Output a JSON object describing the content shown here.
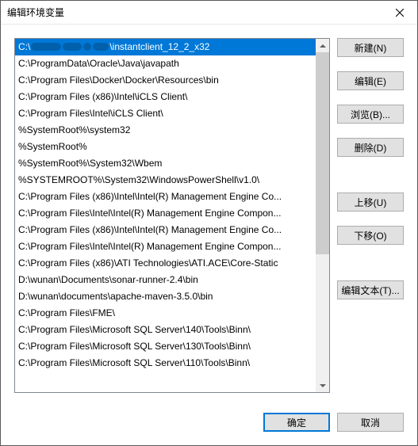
{
  "title": "编辑环境变量",
  "paths": {
    "selected_prefix": "C:\\",
    "selected_suffix": "\\instantclient_12_2_x32",
    "items": [
      "",
      "C:\\ProgramData\\Oracle\\Java\\javapath",
      "C:\\Program Files\\Docker\\Docker\\Resources\\bin",
      "C:\\Program Files (x86)\\Intel\\iCLS Client\\",
      "C:\\Program Files\\Intel\\iCLS Client\\",
      "%SystemRoot%\\system32",
      "%SystemRoot%",
      "%SystemRoot%\\System32\\Wbem",
      "%SYSTEMROOT%\\System32\\WindowsPowerShell\\v1.0\\",
      "C:\\Program Files (x86)\\Intel\\Intel(R) Management Engine Co...",
      "C:\\Program Files\\Intel\\Intel(R) Management Engine Compon...",
      "C:\\Program Files (x86)\\Intel\\Intel(R) Management Engine Co...",
      "C:\\Program Files\\Intel\\Intel(R) Management Engine Compon...",
      "C:\\Program Files (x86)\\ATI Technologies\\ATI.ACE\\Core-Static",
      "D:\\wunan\\Documents\\sonar-runner-2.4\\bin",
      "D:\\wunan\\documents\\apache-maven-3.5.0\\bin",
      "C:\\Program Files\\FME\\",
      "C:\\Program Files\\Microsoft SQL Server\\140\\Tools\\Binn\\",
      "C:\\Program Files\\Microsoft SQL Server\\130\\Tools\\Binn\\",
      "C:\\Program Files\\Microsoft SQL Server\\110\\Tools\\Binn\\"
    ]
  },
  "buttons": {
    "new": "新建(N)",
    "edit": "编辑(E)",
    "browse": "浏览(B)...",
    "delete": "删除(D)",
    "move_up": "上移(U)",
    "move_down": "下移(O)",
    "edit_text": "编辑文本(T)...",
    "ok": "确定",
    "cancel": "取消"
  }
}
